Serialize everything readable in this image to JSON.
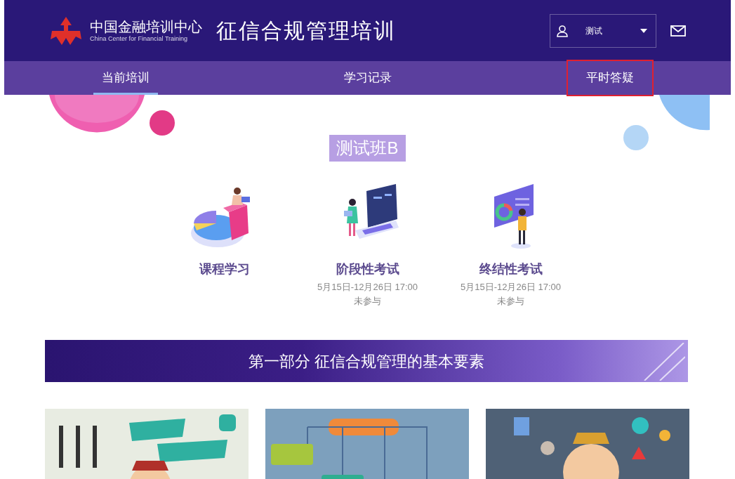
{
  "header": {
    "org_name": "中国金融培训中心",
    "org_name_en": "China Center for Financial Training",
    "site_title": "征信合规管理培训",
    "user": {
      "name": "测试"
    }
  },
  "nav": [
    {
      "label": "当前培训",
      "selected": true,
      "highlighted": false
    },
    {
      "label": "学习记录",
      "selected": false,
      "highlighted": false
    },
    {
      "label": "平时答疑",
      "selected": false,
      "highlighted": true
    }
  ],
  "class_name": "测试班B",
  "modules": [
    {
      "kind": "course",
      "title": "课程学习"
    },
    {
      "kind": "stage_exam",
      "title": "阶段性考试",
      "period": "5月15日-12月26日 17:00",
      "status": "未参与"
    },
    {
      "kind": "final_exam",
      "title": "终结性考试",
      "period": "5月15日-12月26日 17:00",
      "status": "未参与"
    }
  ],
  "section": {
    "title": "第一部分 征信合规管理的基本要素"
  }
}
